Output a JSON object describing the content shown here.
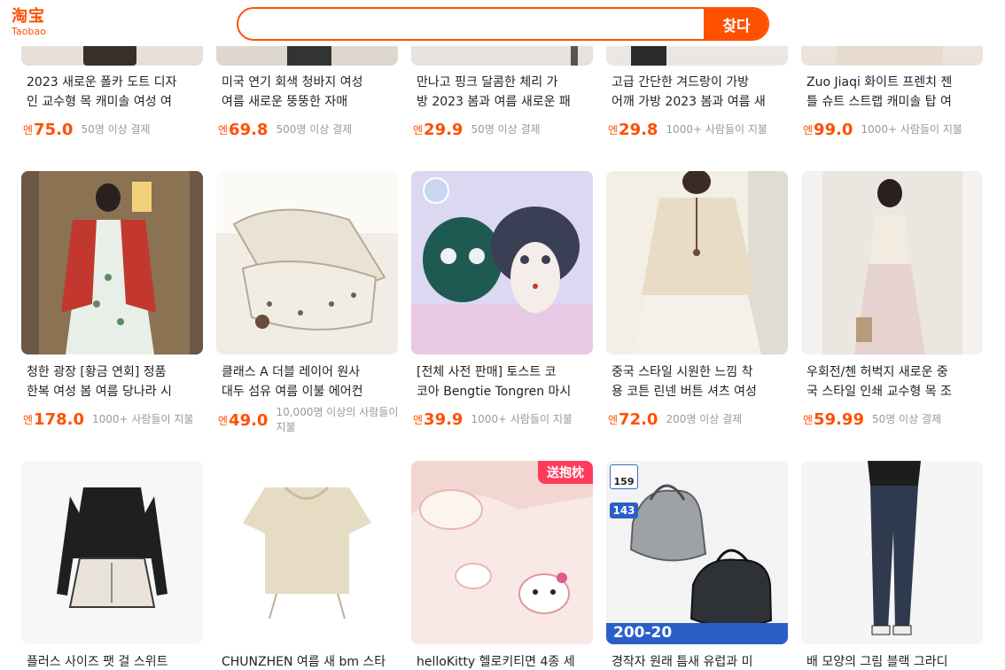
{
  "header": {
    "logo_cn": "淘宝",
    "logo_en": "Taobao",
    "search_value": "",
    "search_button": "찾다"
  },
  "products": [
    {
      "title1": "2023 새로운 폴카 도트 디자",
      "title2": "인 교수형 목 캐미솔 여성 여",
      "currency": "엔",
      "price": "75.0",
      "sales": "50명 이상 결제",
      "image": "top-photo"
    },
    {
      "title1": "미국 연기 회색 청바지 여성",
      "title2": "여름 새로운 뚱뚱한 자매",
      "currency": "엔",
      "price": "69.8",
      "sales": "500명 이상 결제",
      "image": "jeans-photo"
    },
    {
      "title1": "만나고 핑크 달콤한 체리 가",
      "title2": "방 2023 봄과 여름 새로운 패",
      "currency": "엔",
      "price": "29.9",
      "sales": "50명 이상 결제",
      "image": "bag-photo"
    },
    {
      "title1": "고급 간단한 겨드랑이 가방",
      "title2": "어깨 가방 2023 봄과 여름 새",
      "currency": "엔",
      "price": "29.8",
      "sales": "1000+ 사람들이 지불",
      "image": "bag-photo"
    },
    {
      "title1": "Zuo Jiaqi 화이트 프렌치 젠",
      "title2": "틀 슈트 스트랩 캐미솔 탑 여",
      "currency": "엔",
      "price": "99.0",
      "sales": "1000+ 사람들이 지불",
      "image": "top-photo"
    },
    {
      "title1": "청한 광장 [황금 연회] 정품",
      "title2": "한복 여성 봄 여름 당나라 시",
      "currency": "엔",
      "price": "178.0",
      "sales": "1000+ 사람들이 지불",
      "image": "hanfu-photo"
    },
    {
      "title1": "클래스 A 더블 레이어 원사",
      "title2": "대두 섬유 여름 이불 에어컨",
      "currency": "엔",
      "price": "49.0",
      "sales": "10,000명 이상의 사람들이 지불",
      "image": "quilt-photo"
    },
    {
      "title1": "[전체 사전 판매] 토스트 코",
      "title2": "코아 Bengtie Tongren 마시",
      "currency": "엔",
      "price": "39.9",
      "sales": "1000+ 사람들이 지불",
      "image": "plush-photo"
    },
    {
      "title1": "중국 스타일 시원한 느낌 착",
      "title2": "용 코튼 린넨 버튼 셔츠 여성",
      "currency": "엔",
      "price": "72.0",
      "sales": "200명 이상 결제",
      "image": "shirt-photo"
    },
    {
      "title1": "우회전/첸 허벅지 새로운 중",
      "title2": "국 스타일 인쇄 교수형 목 조",
      "currency": "엔",
      "price": "59.99",
      "sales": "50명 이상 결제",
      "image": "dress-photo"
    },
    {
      "title1": "플러스 사이즈 팻 걸 스위트",
      "title2": "",
      "currency": "",
      "price": "",
      "sales": "",
      "image": "outfit-photo"
    },
    {
      "title1": "CHUNZHEN 여름 새 bm 스타",
      "title2": "",
      "currency": "",
      "price": "",
      "sales": "",
      "image": "tshirt-photo"
    },
    {
      "title1": "helloKitty 헬로키티면 4종 세",
      "title2": "",
      "currency": "",
      "price": "",
      "sales": "",
      "image": "bedding-photo",
      "badge": "送抱枕"
    },
    {
      "title1": "경작자 원래 틈새 유럽과 미",
      "title2": "",
      "currency": "",
      "price": "",
      "sales": "",
      "image": "handbag-photo",
      "tag_top": "159",
      "tag_mid": "143",
      "tag_bottom": "200-20"
    },
    {
      "title1": "배 모양의 그림 블랙 그라디",
      "title2": "",
      "currency": "",
      "price": "",
      "sales": "",
      "image": "pants-photo"
    }
  ]
}
